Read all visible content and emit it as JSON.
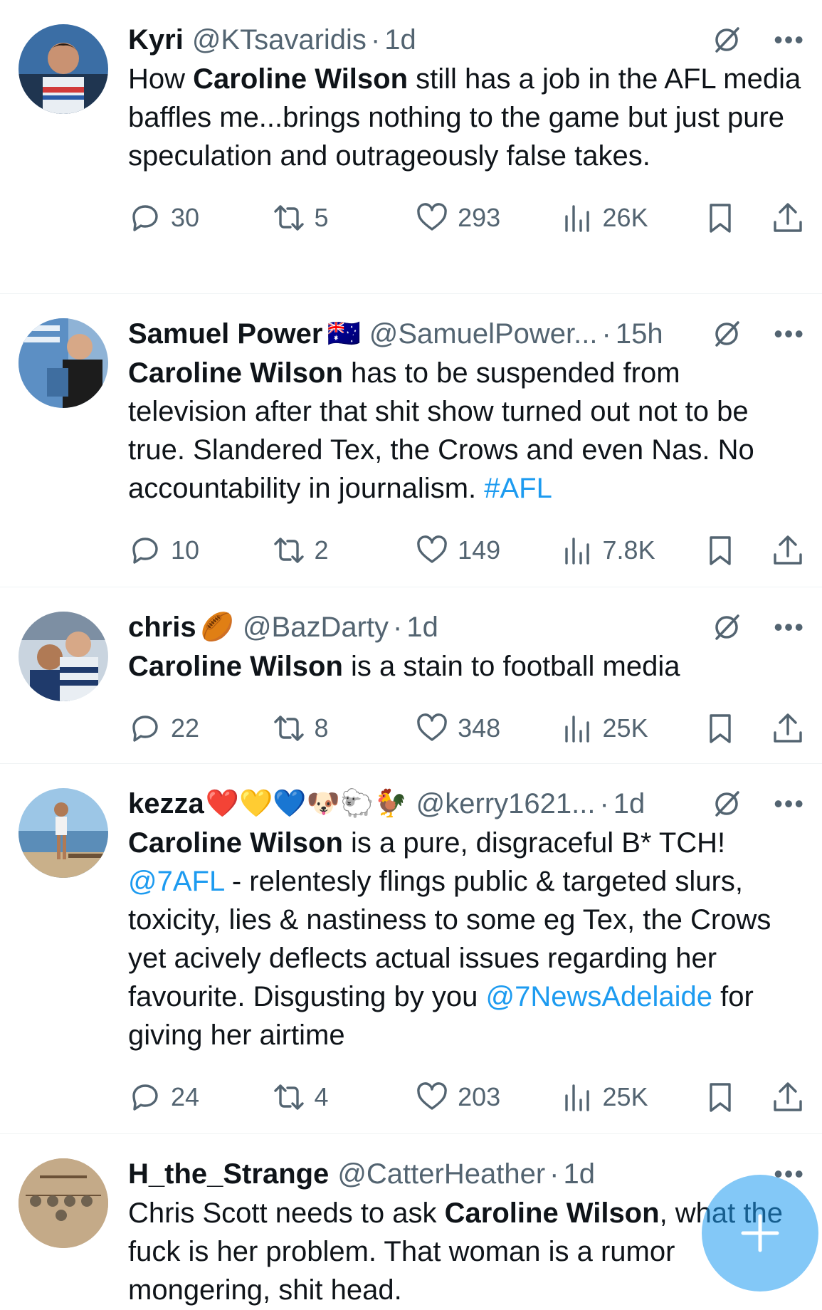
{
  "tweets": [
    {
      "name": "Kyri",
      "emojis": "",
      "handle": "@KTsavaridis",
      "time": "1d",
      "text": [
        {
          "t": "How "
        },
        {
          "b": "Caroline Wilson"
        },
        {
          "t": " still has a job in the AFL media baffles me...brings nothing to the game but just pure speculation and outrageously false takes."
        }
      ],
      "replies": "30",
      "retweets": "5",
      "likes": "293",
      "views": "26K"
    },
    {
      "name": "Samuel Power",
      "emojis": "🇦🇺",
      "handle": "@SamuelPower...",
      "time": "15h",
      "text": [
        {
          "b": "Caroline Wilson"
        },
        {
          "t": " has to be suspended from television after that shit show turned out not to be true. Slandered Tex, the Crows and even Nas. No accountability in journalism. "
        },
        {
          "l": "#AFL"
        }
      ],
      "replies": "10",
      "retweets": "2",
      "likes": "149",
      "views": "7.8K"
    },
    {
      "name": "chris",
      "emojis": "🏉",
      "handle": "@BazDarty",
      "time": "1d",
      "text": [
        {
          "b": "Caroline Wilson"
        },
        {
          "t": " is a stain to football media"
        }
      ],
      "replies": "22",
      "retweets": "8",
      "likes": "348",
      "views": "25K"
    },
    {
      "name": "kezza",
      "emojis": "❤️💛💙🐶🐑🐓",
      "handle": "@kerry1621...",
      "time": "1d",
      "text": [
        {
          "b": "Caroline Wilson"
        },
        {
          "t": " is a pure, disgraceful B* TCH! "
        },
        {
          "l": "@7AFL"
        },
        {
          "t": " - relentesly flings public & targeted slurs, toxicity, lies & nastiness to some eg Tex, the Crows yet acively deflects actual issues regarding her favourite. Disgusting by you "
        },
        {
          "l": "@7NewsAdelaide"
        },
        {
          "t": " for giving her airtime"
        }
      ],
      "replies": "24",
      "retweets": "4",
      "likes": "203",
      "views": "25K"
    },
    {
      "name": "H_the_Strange",
      "emojis": "",
      "handle": "@CatterHeather",
      "time": "1d",
      "text": [
        {
          "t": "Chris Scott needs to ask "
        },
        {
          "b": "Caroline Wilson"
        },
        {
          "t": ", what the fuck is her problem. That woman is a rumor mongering, shit head."
        }
      ],
      "replies": "",
      "retweets": "",
      "likes": "",
      "views": ""
    }
  ],
  "separator": "·",
  "more_label": "•••",
  "icons": {
    "reply": "reply-icon",
    "retweet": "retweet-icon",
    "like": "heart-icon",
    "views": "views-icon",
    "bookmark": "bookmark-icon",
    "share": "share-icon",
    "grok": "grok-icon",
    "compose": "compose-plus-icon"
  },
  "colors": {
    "link": "#1d9bf0",
    "secondary": "#536471",
    "fab": "#1d9bf0"
  }
}
